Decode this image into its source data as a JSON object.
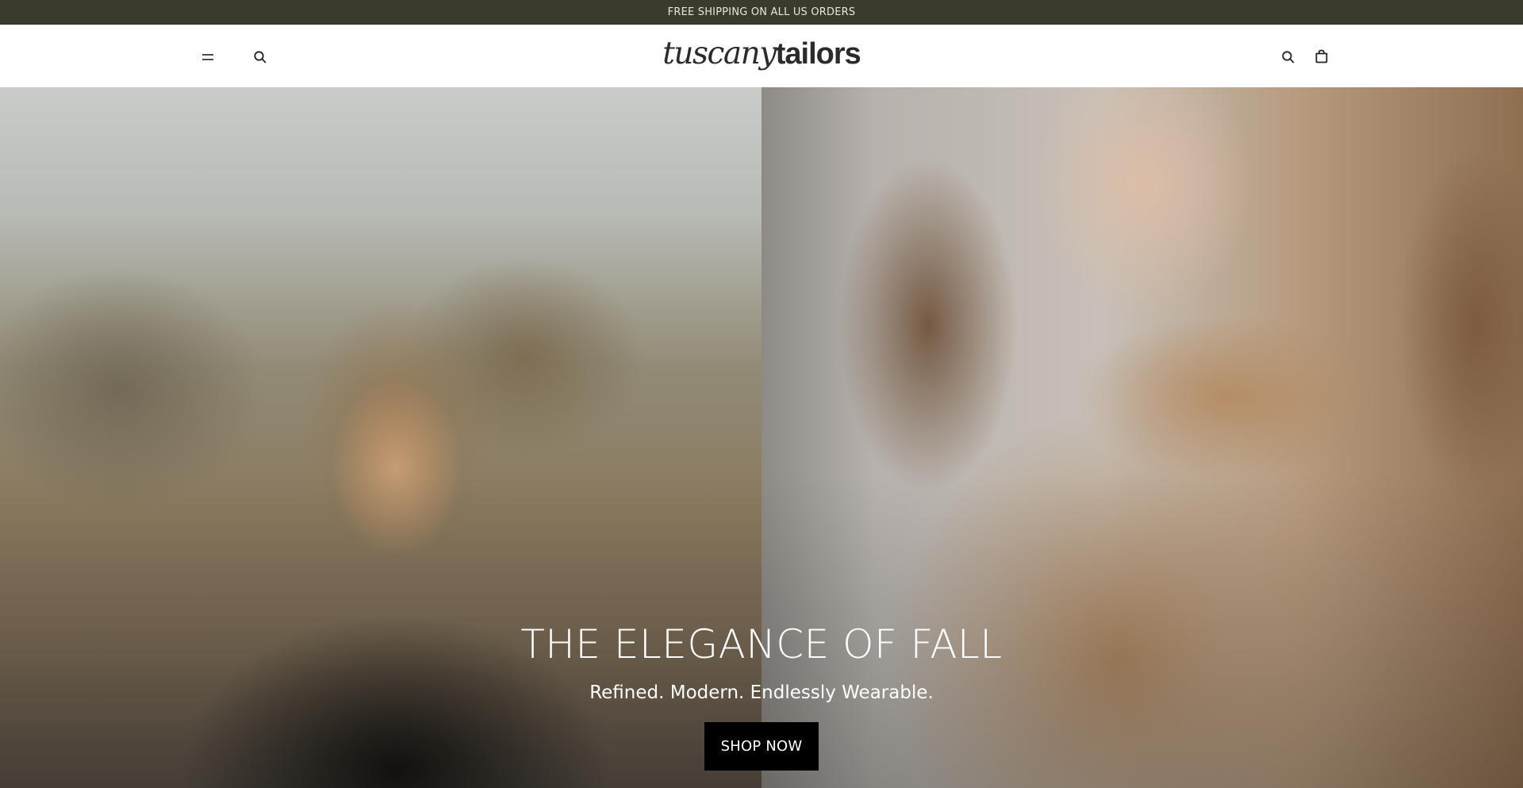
{
  "announcement": {
    "text": "FREE SHIPPING ON ALL US ORDERS"
  },
  "header": {
    "logo": {
      "script_part": "tuscany",
      "bold_part": "tailors"
    },
    "icons": {
      "menu": "menu-icon",
      "search_left": "search-icon",
      "search_right": "search-icon",
      "cart": "shopping-bag-icon"
    }
  },
  "hero": {
    "title": "THE ELEGANCE OF FALL",
    "subtitle": "Refined. Modern. Endlessly Wearable.",
    "cta_label": "SHOP NOW"
  },
  "colors": {
    "announcement_bg": "#3a3b2c",
    "announcement_text": "#e6e6dc",
    "header_bg": "#ffffff",
    "logo": "#2b2b2b",
    "cta_bg": "#000000",
    "cta_text": "#ffffff"
  }
}
